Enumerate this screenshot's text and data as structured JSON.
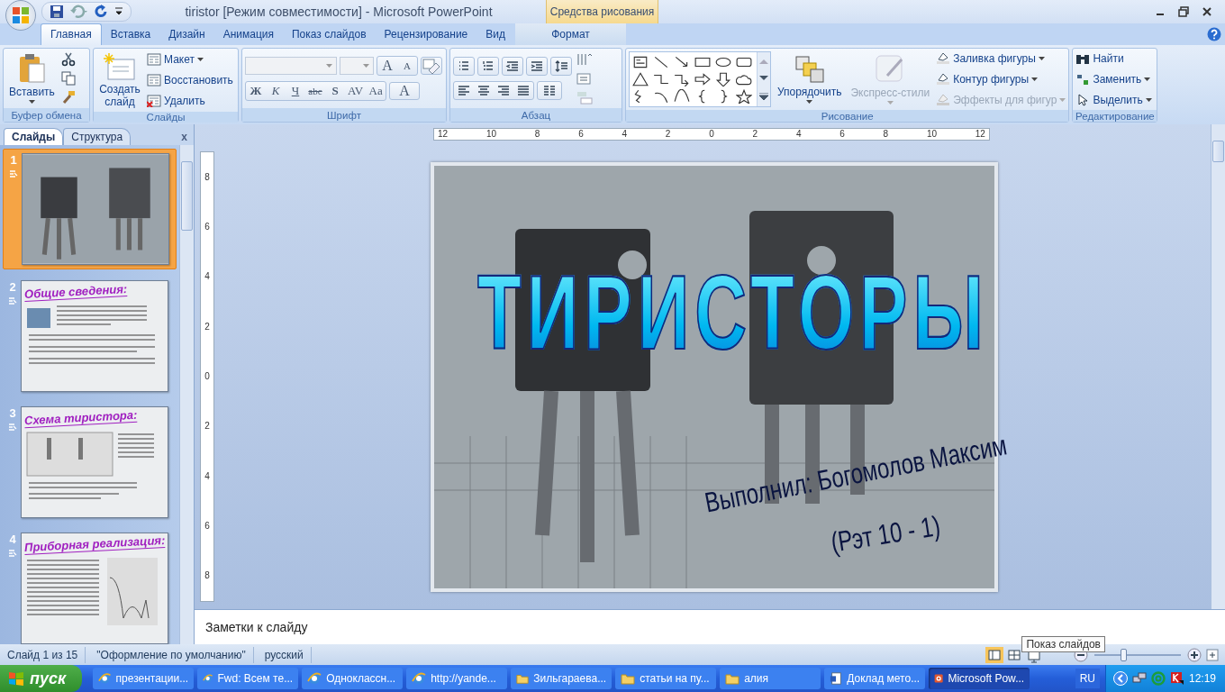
{
  "window": {
    "title": "tiristor [Режим совместимости] - Microsoft PowerPoint",
    "context_tab_group": "Средства рисования"
  },
  "tabs": [
    {
      "label": "Главная",
      "selected": true,
      "contextual": false
    },
    {
      "label": "Вставка",
      "selected": false,
      "contextual": false
    },
    {
      "label": "Дизайн",
      "selected": false,
      "contextual": false
    },
    {
      "label": "Анимация",
      "selected": false,
      "contextual": false
    },
    {
      "label": "Показ слайдов",
      "selected": false,
      "contextual": false
    },
    {
      "label": "Рецензирование",
      "selected": false,
      "contextual": false
    },
    {
      "label": "Вид",
      "selected": false,
      "contextual": false
    },
    {
      "label": "Формат",
      "selected": false,
      "contextual": true
    }
  ],
  "ribbon": [
    {
      "kind": "clipboard",
      "title": "Буфер обмена",
      "paste": "Вставить"
    },
    {
      "kind": "slides",
      "title": "Слайды",
      "new_slide": "Создать слайд",
      "commands": [
        {
          "label": "Макет",
          "menu": true
        },
        {
          "label": "Восстановить",
          "menu": false
        },
        {
          "label": "Удалить",
          "menu": false
        }
      ]
    },
    {
      "kind": "font",
      "title": "Шрифт",
      "grow": "A",
      "shrink": "A",
      "styles": [
        "Ж",
        "К",
        "Ч",
        "abc",
        "S",
        "AV",
        "Aa"
      ],
      "color_button": "A"
    },
    {
      "kind": "paragraph",
      "title": "Абзац"
    },
    {
      "kind": "drawing",
      "title": "Рисование",
      "arrange": "Упорядочить",
      "quick_styles": {
        "label": "Экспресс-стили",
        "disabled": true
      },
      "commands": [
        {
          "label": "Заливка фигуры",
          "disabled": false
        },
        {
          "label": "Контур фигуры",
          "disabled": false
        },
        {
          "label": "Эффекты для фигур",
          "disabled": true
        }
      ]
    },
    {
      "kind": "editing",
      "title": "Редактирование",
      "commands": [
        {
          "label": "Найти",
          "menu": false
        },
        {
          "label": "Заменить",
          "menu": true
        },
        {
          "label": "Выделить",
          "menu": true
        }
      ]
    }
  ],
  "pane": {
    "tabs": [
      {
        "label": "Слайды",
        "selected": true
      },
      {
        "label": "Структура",
        "selected": false
      }
    ],
    "close": "x",
    "slides": [
      {
        "number": "1",
        "kind": "title",
        "selected": true
      },
      {
        "number": "2",
        "kind": "photo",
        "title": "Общие сведения:",
        "selected": false
      },
      {
        "number": "3",
        "kind": "diagram",
        "title": "Схема тиристора:",
        "selected": false
      },
      {
        "number": "4",
        "kind": "chart",
        "title": "Приборная реализация:",
        "selected": false
      }
    ]
  },
  "ruler": {
    "horizontal": [
      "12",
      "10",
      "8",
      "6",
      "4",
      "2",
      "0",
      "2",
      "4",
      "6",
      "8",
      "10",
      "12"
    ],
    "vertical": [
      "8",
      "6",
      "4",
      "2",
      "0",
      "2",
      "4",
      "6",
      "8"
    ]
  },
  "slide": {
    "title": "ТИРИСТОРЫ",
    "author": "Выполнил: Богомолов Максим",
    "group": "(Рэт 10 - 1)"
  },
  "notes": {
    "placeholder": "Заметки к слайду"
  },
  "status_bar": {
    "items": [
      "Слайд 1 из 15",
      "\"Оформление по умолчанию\"",
      "русский"
    ],
    "views": [
      {
        "kind": "normal",
        "selected": true
      },
      {
        "kind": "sorter",
        "selected": false
      },
      {
        "kind": "show",
        "selected": false
      }
    ],
    "zoom": {
      "level": 0.33
    },
    "tooltip": "Показ слайдов"
  },
  "taskbar": {
    "start": "пуск",
    "tasks": [
      {
        "label": "презентации...",
        "kind": "browser",
        "selected": false
      },
      {
        "label": "Fwd: Всем те...",
        "kind": "browser",
        "selected": false
      },
      {
        "label": "Одноклассн...",
        "kind": "browser",
        "selected": false
      },
      {
        "label": "http://yande...",
        "kind": "browser",
        "selected": false
      },
      {
        "label": "Зильгараева...",
        "kind": "folder",
        "selected": false
      },
      {
        "label": "статьи на пу...",
        "kind": "folder",
        "selected": false
      },
      {
        "label": "алия",
        "kind": "folder",
        "selected": false
      },
      {
        "label": "Доклад мето...",
        "kind": "document",
        "selected": false
      },
      {
        "label": "Microsoft Pow...",
        "kind": "presentation",
        "selected": true
      }
    ],
    "language": "RU",
    "time": "12:19"
  }
}
